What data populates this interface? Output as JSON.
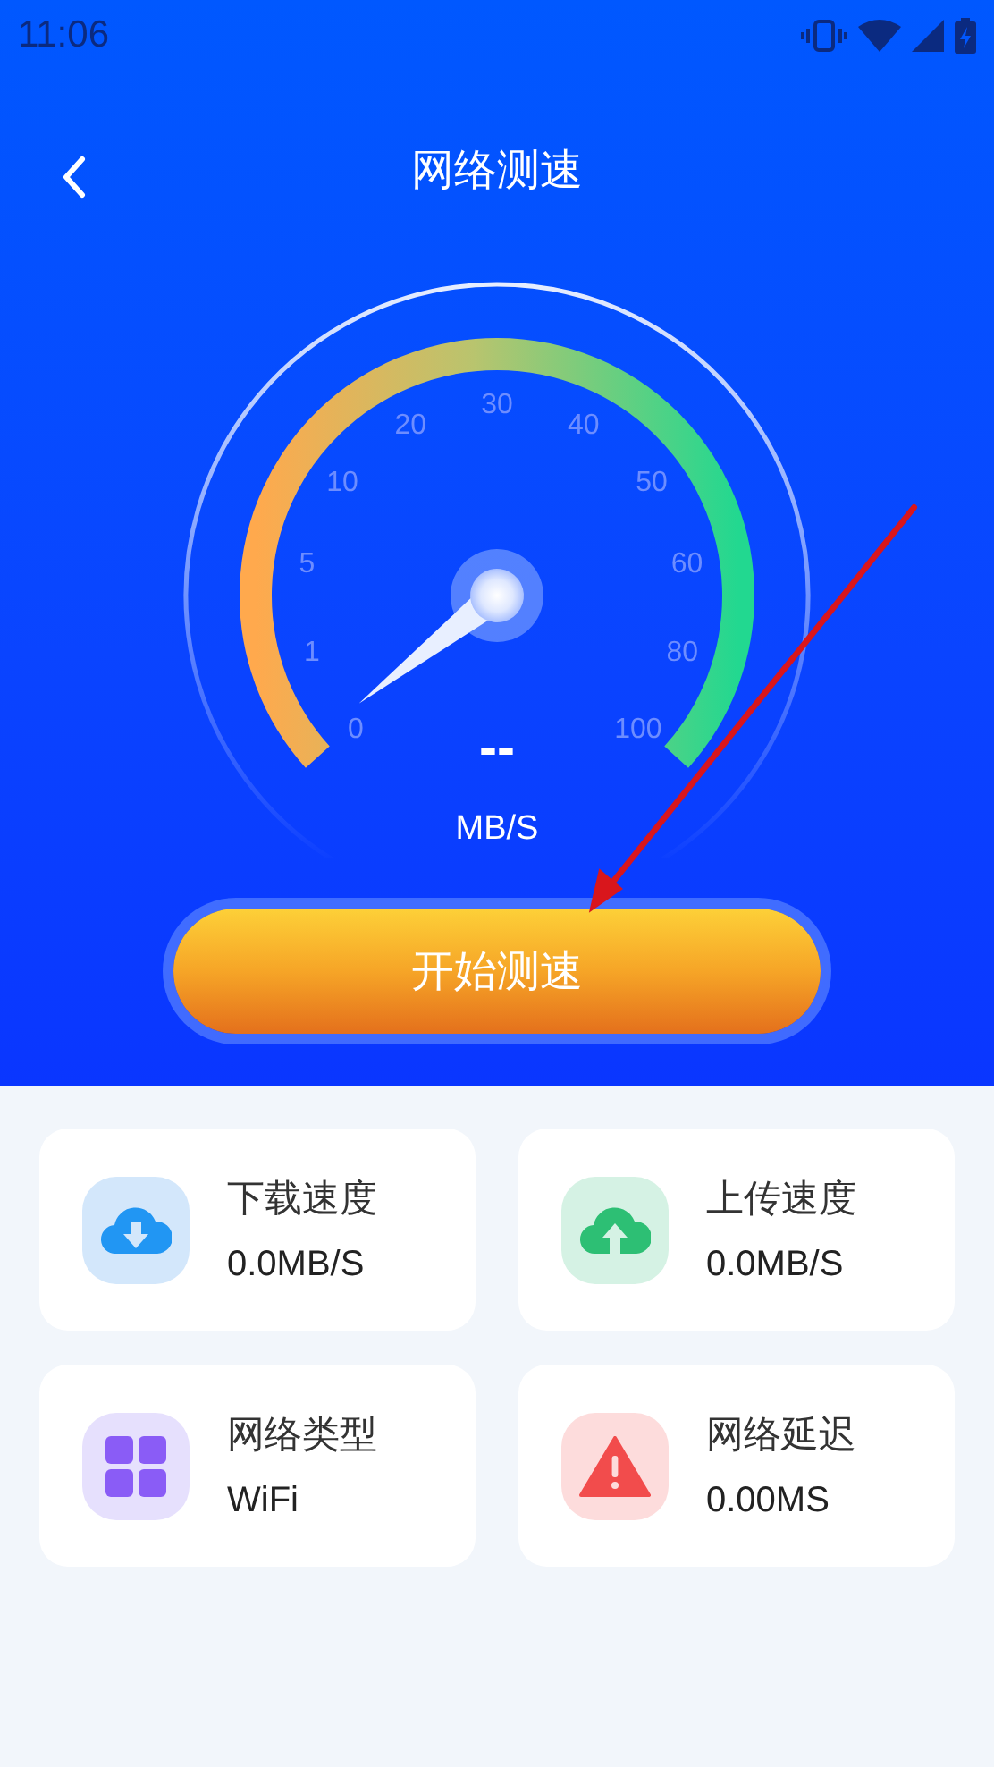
{
  "status_bar": {
    "time": "11:06"
  },
  "header": {
    "title": "网络测速"
  },
  "gauge": {
    "ticks": [
      "0",
      "1",
      "5",
      "10",
      "20",
      "30",
      "40",
      "50",
      "60",
      "80",
      "100"
    ],
    "reading": "--",
    "unit": "MB/S"
  },
  "start_button": {
    "label": "开始测速"
  },
  "stats": [
    {
      "kind": "download",
      "label": "下载速度",
      "value": "0.0MB/S"
    },
    {
      "kind": "upload",
      "label": "上传速度",
      "value": "0.0MB/S"
    },
    {
      "kind": "network",
      "label": "网络类型",
      "value": "WiFi"
    },
    {
      "kind": "latency",
      "label": "网络延迟",
      "value": "0.00MS"
    }
  ]
}
